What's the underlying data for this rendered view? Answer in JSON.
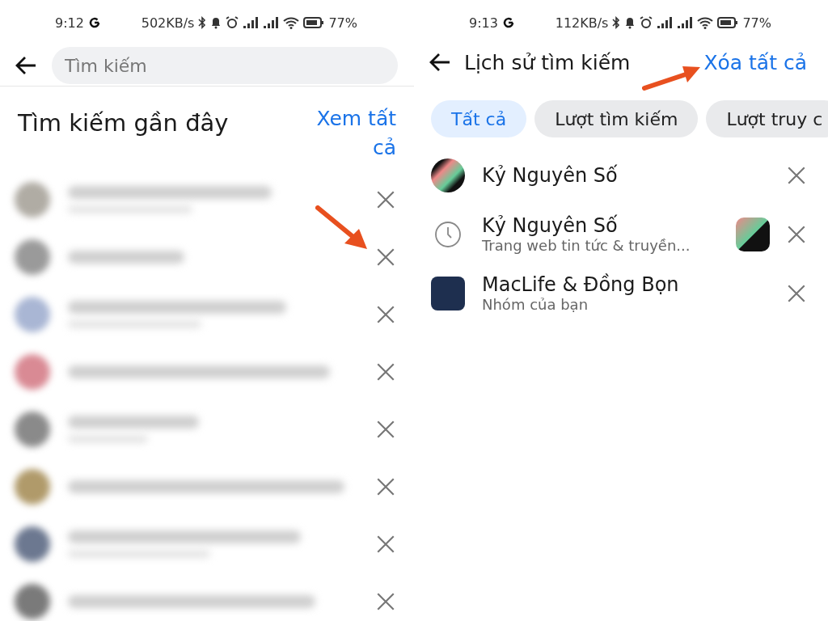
{
  "left": {
    "status_bar": {
      "time": "9:12",
      "speed": "502KB/s",
      "battery": "77%"
    },
    "search": {
      "placeholder": "Tìm kiếm"
    },
    "heading": "Tìm kiếm gần đây",
    "see_all": "Xem tất cả",
    "recent": [
      {
        "color": "#b0aca4"
      },
      {
        "color": "#9a9a9a"
      },
      {
        "color": "#a9b6d4"
      },
      {
        "color": "#d98a94"
      },
      {
        "color": "#8a8a8a"
      },
      {
        "color": "#b09a6a"
      },
      {
        "color": "#6c7890"
      },
      {
        "color": "#7a7a7a"
      }
    ]
  },
  "right": {
    "status_bar": {
      "time": "9:13",
      "speed": "112KB/s",
      "battery": "77%"
    },
    "title": "Lịch sử tìm kiếm",
    "clear_all": "Xóa tất cả",
    "chips": [
      {
        "label": "Tất cả",
        "selected": true
      },
      {
        "label": "Lượt tìm kiếm",
        "selected": false
      },
      {
        "label": "Lượt truy c",
        "selected": false
      }
    ],
    "history": [
      {
        "kind": "page",
        "title": "Kỷ Nguyên Số"
      },
      {
        "kind": "search",
        "title": "Kỷ Nguyên Số",
        "subtitle": "Trang web tin tức & truyền..."
      },
      {
        "kind": "group",
        "title": "MacLife & Đồng Bọn",
        "subtitle": "Nhóm của bạn"
      }
    ]
  }
}
